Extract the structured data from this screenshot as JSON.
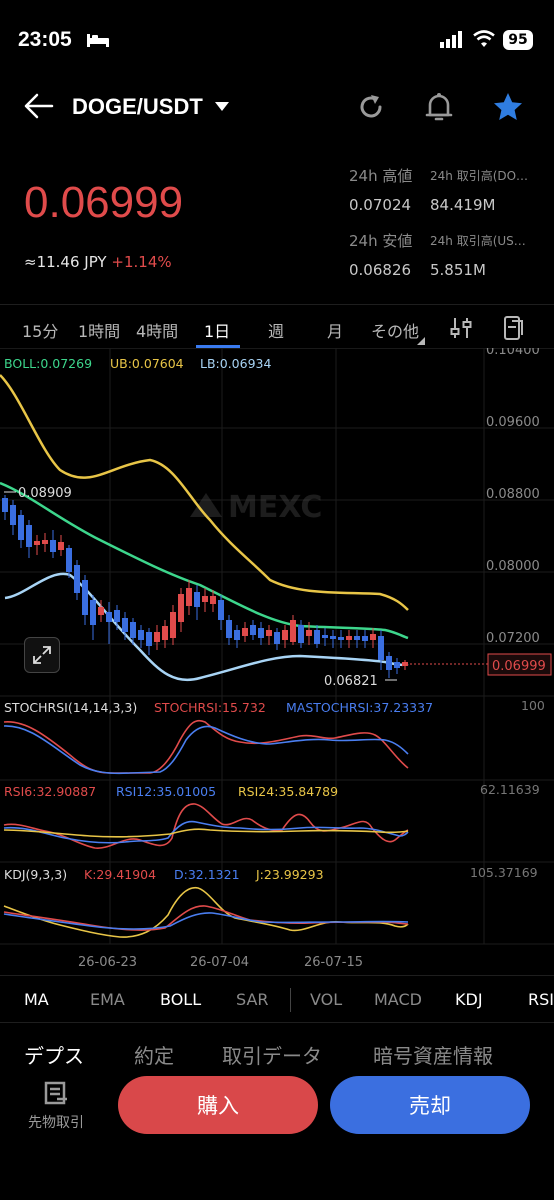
{
  "status_bar": {
    "time": "23:05",
    "battery": "95"
  },
  "header": {
    "pair": "DOGE/USDT"
  },
  "price": {
    "last": "0.06999",
    "jpy": "≈11.46",
    "jpy_unit": "JPY",
    "change": "+1.14%",
    "high_label": "24h 高値",
    "high_value": "0.07024",
    "vol_coin_label": "24h 取引高(DO…",
    "vol_coin_value": "84.419M",
    "low_label": "24h 安値",
    "low_value": "0.06826",
    "vol_usdt_label": "24h 取引高(US…",
    "vol_usdt_value": "5.851M"
  },
  "intervals": [
    "15分",
    "1時間",
    "4時間",
    "1日",
    "週",
    "月",
    "その他"
  ],
  "active_interval": "1日",
  "chart_data": {
    "type": "candlestick",
    "boll_label": "BOLL:0.07269",
    "ub_label": "UB:0.07604",
    "lb_label": "LB:0.06934",
    "y_ticks": [
      "0.10400",
      "0.09600",
      "0.08800",
      "0.08000",
      "0.07200"
    ],
    "current_price_tag": "0.06999",
    "max_label": "0.08909",
    "min_label": "0.06821",
    "watermark": "MEXC",
    "x_ticks": [
      "26-06-23",
      "26-07-04",
      "26-07-15"
    ],
    "stochrsi_labels": [
      "STOCHRSI(14,14,3,3)",
      "STOCHRSI:15.732",
      "MASTOCHRSI:37.23337"
    ],
    "stochrsi_max": "100",
    "rsi_labels": [
      "RSI6:32.90887",
      "RSI12:35.01005",
      "RSI24:35.84789"
    ],
    "rsi_max": "62.11639",
    "kdj_labels": [
      "KDJ(9,3,3)",
      "K:29.41904",
      "D:32.1321",
      "J:23.99293"
    ],
    "kdj_max": "105.37169",
    "colors": {
      "up": "#e04b4b",
      "down": "#3a6ee0",
      "boll": "#3dd68c",
      "ub": "#e8c547",
      "lb": "#a8d4f5"
    }
  },
  "indicators": [
    "MA",
    "EMA",
    "BOLL",
    "SAR",
    "VOL",
    "MACD",
    "KDJ",
    "RSI"
  ],
  "bottom_tabs": [
    "デプス",
    "約定",
    "取引データ",
    "暗号資産情報"
  ],
  "futures_label": "先物取引",
  "buy_label": "購入",
  "sell_label": "売却"
}
